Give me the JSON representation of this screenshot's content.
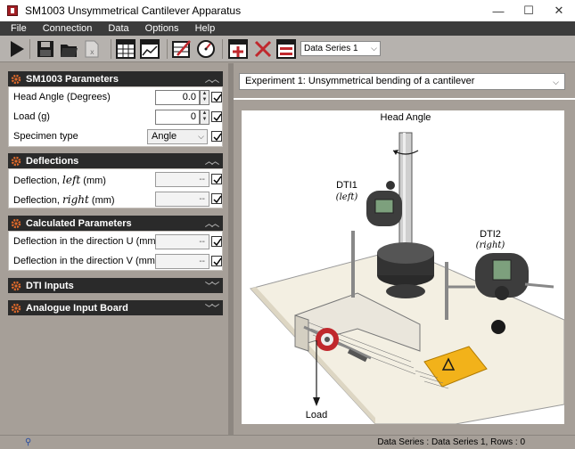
{
  "window": {
    "title": "SM1003 Unsymmetrical Cantilever Apparatus",
    "minimize": "—",
    "maximize": "☐",
    "close": "✕"
  },
  "menu": [
    "File",
    "Connection",
    "Data",
    "Options",
    "Help"
  ],
  "toolbar": {
    "data_series_select": "Data Series 1"
  },
  "sections": {
    "sm1003": {
      "title": "SM1003 Parameters",
      "head_angle_label": "Head Angle (Degrees)",
      "head_angle_value": "0.0",
      "load_label": "Load (g)",
      "load_value": "0",
      "specimen_label": "Specimen type",
      "specimen_value": "Angle"
    },
    "deflections": {
      "title": "Deflections",
      "left_prefix": "Deflection, ",
      "left_var": "left",
      "left_unit": " (mm)",
      "left_value": "--",
      "right_prefix": "Deflection, ",
      "right_var": "right",
      "right_unit": " (mm)",
      "right_value": "--"
    },
    "calculated": {
      "title": "Calculated Parameters",
      "u_label": "Deflection in the direction U (mm)",
      "u_value": "--",
      "v_label": "Deflection in the direction V (mm)",
      "v_value": "--"
    },
    "dti_inputs": {
      "title": "DTI Inputs"
    },
    "analogue": {
      "title": "Analogue Input Board"
    }
  },
  "experiment": {
    "selected": "Experiment 1: Unsymmetrical bending of a cantilever"
  },
  "diagram": {
    "head_angle": "Head Angle",
    "dti1": "DTI1",
    "dti1_sub": "(left)",
    "dti2": "DTI2",
    "dti2_sub": "(right)",
    "load": "Load"
  },
  "status": {
    "text": "Data Series : Data Series 1,  Rows : 0"
  },
  "colors": {
    "panel_bg": "#a69f98",
    "header_bg": "#2a2a2a",
    "menubar_bg": "#3c3c3c",
    "accent_red": "#c0282d",
    "warning_yellow": "#f2b21a"
  }
}
